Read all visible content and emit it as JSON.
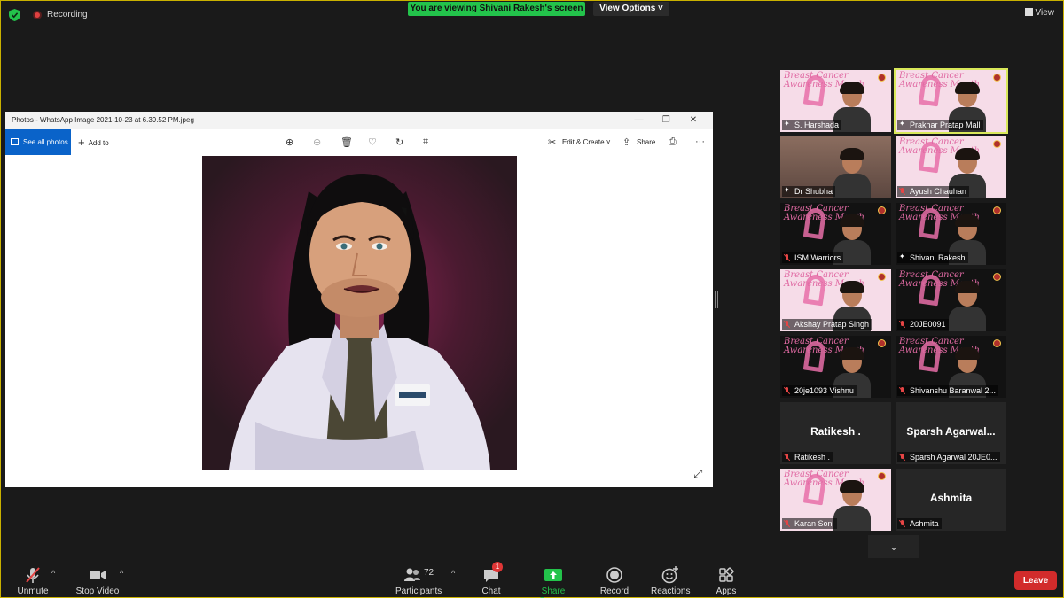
{
  "topbar": {
    "recording_label": "Recording",
    "viewing_banner": "You are viewing Shivani Rakesh's screen",
    "view_options_label": "View Options",
    "view_label": "View"
  },
  "photos_app": {
    "title": "Photos - WhatsApp Image 2021-10-23 at 6.39.52 PM.jpeg",
    "see_all_label": "See all photos",
    "add_to_label": "Add to",
    "edit_create_label": "Edit & Create",
    "share_label": "Share"
  },
  "participants": [
    {
      "name": "S. Harshada",
      "video": true,
      "muted": false,
      "pinned": true
    },
    {
      "name": "Prakhar Pratap Mall",
      "video": true,
      "muted": false,
      "pinned": true,
      "active_speaker": true
    },
    {
      "name": "Dr Shubha",
      "video": true,
      "muted": false,
      "pinned": true
    },
    {
      "name": "Ayush Chauhan",
      "video": true,
      "muted": true
    },
    {
      "name": "ISM Warriors",
      "video": true,
      "muted": true
    },
    {
      "name": "Shivani Rakesh",
      "video": true,
      "muted": false
    },
    {
      "name": "Akshay Pratap Singh",
      "video": true,
      "muted": true
    },
    {
      "name": "20JE0091",
      "video": true,
      "muted": true
    },
    {
      "name": "20je1093 Vishnu",
      "video": true,
      "muted": true
    },
    {
      "name": "Shivanshu Baranwal 2...",
      "video": true,
      "muted": true
    },
    {
      "name": "Ratikesh .",
      "big_name": "Ratikesh .",
      "video": false,
      "muted": true
    },
    {
      "name": "Sparsh Agarwal 20JE0...",
      "big_name": "Sparsh  Agarwal...",
      "video": false,
      "muted": true
    },
    {
      "name": "Karan Soni",
      "video": true,
      "muted": true
    },
    {
      "name": "Ashmita",
      "big_name": "Ashmita",
      "video": false,
      "muted": true
    }
  ],
  "toolbar": {
    "unmute_label": "Unmute",
    "stop_video_label": "Stop Video",
    "participants_label": "Participants",
    "participants_count": "72",
    "chat_label": "Chat",
    "chat_badge": "1",
    "share_screen_label": "Share Screen",
    "record_label": "Record",
    "reactions_label": "Reactions",
    "apps_label": "Apps",
    "leave_label": "Leave"
  },
  "banner_text": {
    "line1": "Breast Cancer",
    "line2": "Awareness Month"
  },
  "colors": {
    "share_green": "#23c34b",
    "leave_red": "#d22b2b",
    "photos_blue": "#0a63c9",
    "active_speaker": "#d9e85a",
    "awareness_pink": "#e06aa3"
  }
}
